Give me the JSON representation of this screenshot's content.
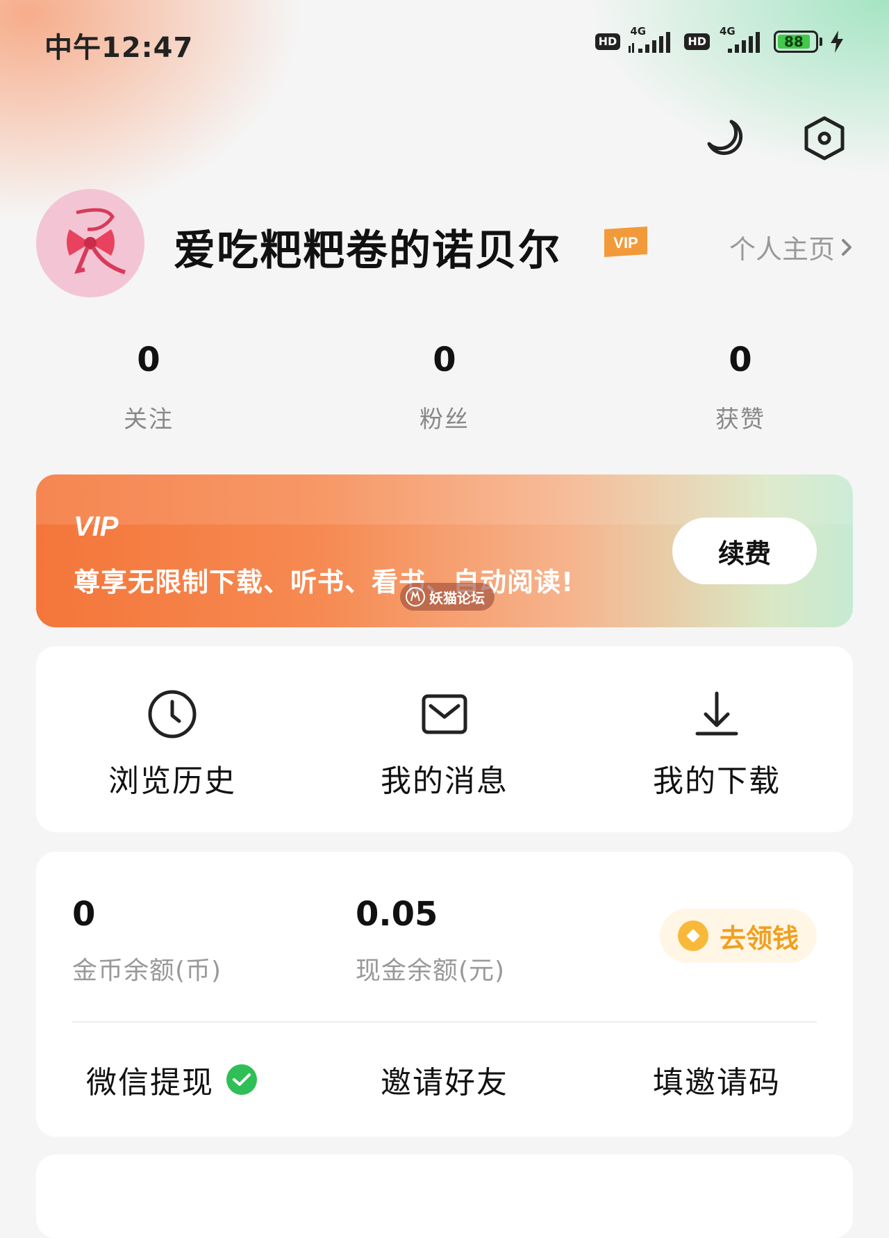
{
  "status_bar": {
    "time": "中午12:47",
    "sim1_badge": "HD",
    "sim1_network": "4G",
    "sim2_badge": "HD",
    "sim2_network": "4G",
    "battery": "88",
    "battery_level_percent": 88,
    "charging": true
  },
  "header": {
    "night_mode_icon": "moon-icon",
    "settings_icon": "hexagon-settings-icon"
  },
  "profile": {
    "username": "爱吃粑粑卷的诺贝尔",
    "vip_badge": "VIP",
    "homepage_link": "个人主页"
  },
  "stats": [
    {
      "value": "0",
      "label": "关注"
    },
    {
      "value": "0",
      "label": "粉丝"
    },
    {
      "value": "0",
      "label": "获赞"
    }
  ],
  "vip_card": {
    "title": "VIP",
    "description": "尊享无限制下载、听书、看书、自动阅读!",
    "renew_label": "续费",
    "watermark": "妖猫论坛"
  },
  "quick_actions": [
    {
      "icon": "clock-icon",
      "label": "浏览历史"
    },
    {
      "icon": "mail-icon",
      "label": "我的消息"
    },
    {
      "icon": "download-icon",
      "label": "我的下载"
    }
  ],
  "wallet": {
    "coins_value": "0",
    "coins_label": "金币余额(币)",
    "cash_value": "0.05",
    "cash_label": "现金余额(元)",
    "earn_label": "去领钱",
    "links": {
      "wechat_withdraw": "微信提现",
      "invite_friends": "邀请好友",
      "enter_invite_code": "填邀请码"
    }
  },
  "colors": {
    "vip_orange": "#f4763a",
    "accent_gold": "#f0a020",
    "wechat_green": "#2fbf56",
    "battery_green": "#42c84a"
  }
}
